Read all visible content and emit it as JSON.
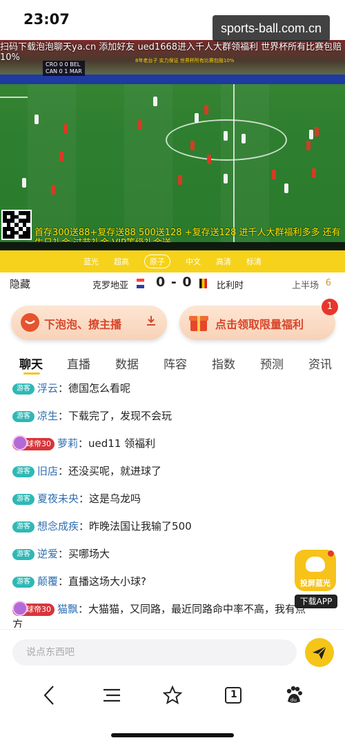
{
  "status_bar": {
    "time": "23:07"
  },
  "watermark": "sports-ball.com.cn",
  "video": {
    "ticker_line1": "扫码下载泡泡聊天ya.cn 添加好友 ued1668进入千人大群领福利 世界杯所有比赛包赔",
    "ticker_line2": "10%",
    "scorebug": [
      "CRO 0 0 BEL",
      "CAN 0 1 MAR"
    ],
    "sponsor": "8年老台子 实力保证 世界杯所有比赛包赔10%",
    "bottom_promo": "首存300送88+复存送88 500送128 +复存送128 进千人大群福利多多 还有生日礼金 过节礼金 VIP等级礼金送"
  },
  "quality": {
    "options": [
      "蓝光",
      "超高",
      "原子",
      "中文",
      "高清",
      "标清"
    ],
    "active_index": 2
  },
  "score": {
    "hide_label": "隐藏",
    "home_team": "克罗地亚",
    "score_text": "0 - 0",
    "away_team": "比利时",
    "period": "上半场",
    "period_num": "6"
  },
  "promo": {
    "left_label": "下泡泡、撩主播",
    "right_label": "点击领取限量福利",
    "right_badge": "1"
  },
  "tabs": [
    "聊天",
    "直播",
    "数据",
    "阵容",
    "指数",
    "预测",
    "资讯"
  ],
  "chat": {
    "guest_label": "游客",
    "messages": [
      {
        "badge": "guest",
        "name": "浮云",
        "text": "德国怎么看呢"
      },
      {
        "badge": "guest",
        "name": "凉生",
        "text": "下载完了，发现不会玩"
      },
      {
        "badge": "king",
        "badge_text": "球帝30",
        "name": "萝莉",
        "text": "ued11 领福利"
      },
      {
        "badge": "guest",
        "name": "旧店",
        "text": "还没买呢，就进球了"
      },
      {
        "badge": "guest",
        "name": "夏夜未央",
        "text": "这是乌龙吗"
      },
      {
        "badge": "guest",
        "name": "想念成疾",
        "text": "昨晚法国让我输了500"
      },
      {
        "badge": "guest",
        "name": "逆爱",
        "text": "买哪场大"
      },
      {
        "badge": "guest",
        "name": "颠覆",
        "text": "直播这场大小球?"
      },
      {
        "badge": "king",
        "badge_text": "球帝30",
        "name": "猫飘",
        "text": "大猫猫，又同路，最近同路命中率不高，我有点方"
      }
    ]
  },
  "cast": {
    "label": "投屏蓝光",
    "download_label": "下载APP"
  },
  "input": {
    "placeholder": "说点东西吧"
  },
  "browser": {
    "tab_count": "1"
  },
  "colors": {
    "accent": "#f5c518",
    "guest_badge": "#2fb8b5",
    "king_badge": "#d7363b",
    "promo_text": "#d8452b"
  }
}
